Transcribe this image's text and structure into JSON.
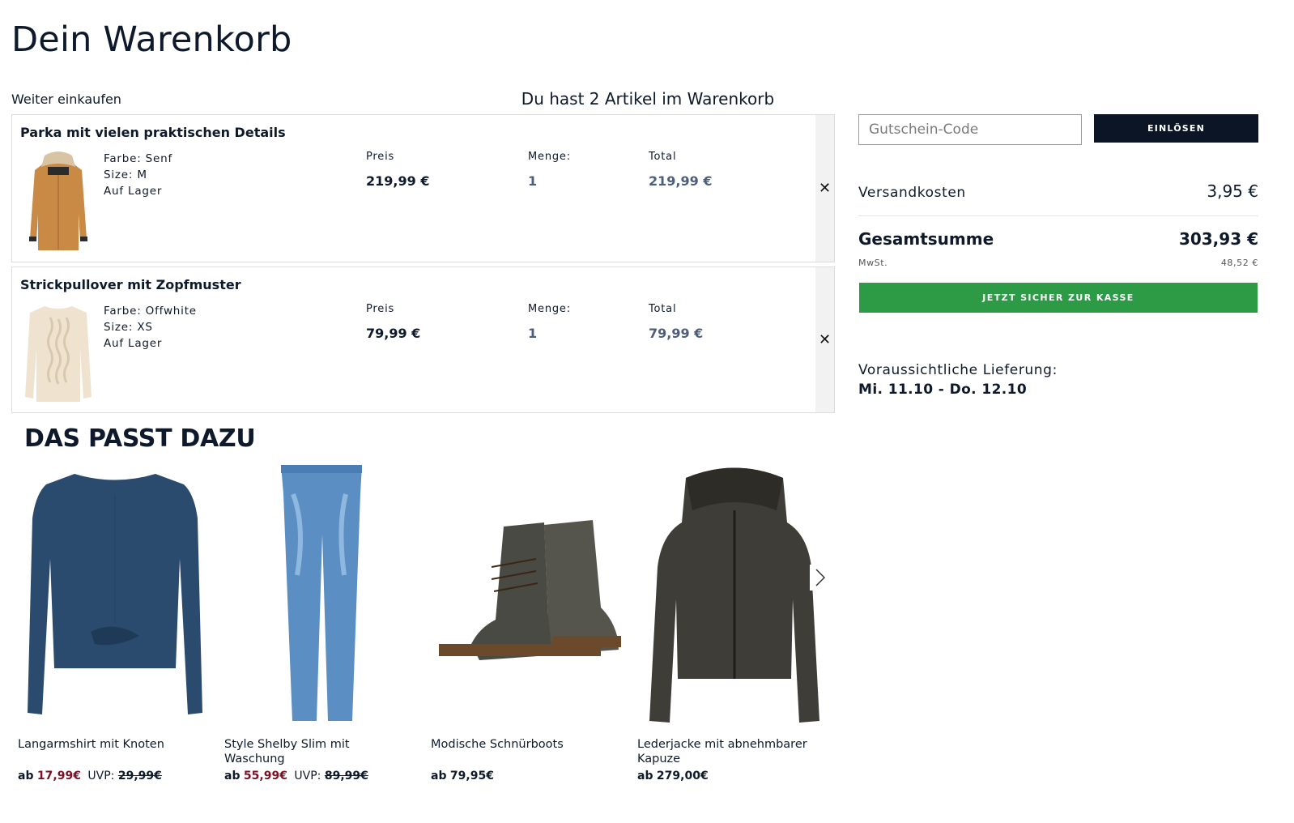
{
  "page": {
    "title": "Dein Warenkorb"
  },
  "cart_header": {
    "continue_label": "Weiter einkaufen",
    "item_count_text": "Du hast 2 Artikel im Warenkorb"
  },
  "cart": {
    "column_labels": {
      "price": "Preis",
      "quantity": "Menge:",
      "total": "Total"
    },
    "remove_symbol": "✕",
    "items": [
      {
        "name": "Parka mit vielen praktischen Details",
        "color": "Farbe: Senf",
        "size": "Size: M",
        "stock": "Auf Lager",
        "price": "219,99 €",
        "quantity": "1",
        "total": "219,99 €",
        "image_color": "#c98a46"
      },
      {
        "name": "Strickpullover mit Zopfmuster",
        "color": "Farbe: Offwhite",
        "size": "Size: XS",
        "stock": "Auf Lager",
        "price": "79,99 €",
        "quantity": "1",
        "total": "79,99 €",
        "image_color": "#efe3d0"
      }
    ]
  },
  "coupon": {
    "placeholder": "Gutschein-Code",
    "button_label": "EINLÖSEN"
  },
  "summary": {
    "shipping_label": "Versandkosten",
    "shipping_value": "3,95 €",
    "total_label": "Gesamtsumme",
    "total_value": "303,93 €",
    "vat_label": "MwSt.",
    "vat_value": "48,52 €",
    "checkout_label": "JETZT SICHER ZUR KASSE"
  },
  "delivery": {
    "label": "Voraussichtliche Lieferung:",
    "date": "Mi. 11.10 - Do. 12.10"
  },
  "recommendations": {
    "title": "DAS PASST DAZU",
    "next_icon": "chevron-right-icon",
    "products": [
      {
        "name": "Langarmshirt mit Knoten",
        "ab": "ab",
        "price": "17,99€",
        "uvp_label": "UVP:",
        "old_price": "29,99€",
        "on_sale": true
      },
      {
        "name": "Style Shelby Slim mit Waschung",
        "ab": "ab",
        "price": "55,99€",
        "uvp_label": "UVP:",
        "old_price": "89,99€",
        "on_sale": true
      },
      {
        "name": "Modische Schnürboots",
        "ab": "ab",
        "price": "79,95€",
        "on_sale": false
      },
      {
        "name": "Lederjacke mit abnehmbarer Kapuze",
        "ab": "ab",
        "price": "279,00€",
        "on_sale": false
      }
    ]
  },
  "colors": {
    "navy": "#0b1526",
    "checkout_green": "#2d9a45",
    "sale_red": "#7a0f25",
    "muted_blue": "#4b5e7a"
  }
}
